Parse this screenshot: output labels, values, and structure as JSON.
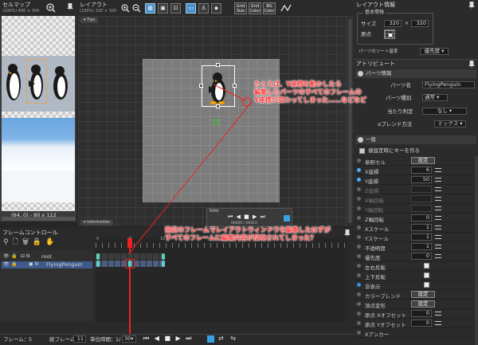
{
  "cellmap": {
    "title": "セルマップ",
    "zoom": "(100%) 400 × 304",
    "status": "(64, 0) - 80 x 112"
  },
  "layout": {
    "title": "レイアウト",
    "zoom": "(100%) 320 × 320",
    "tab": "▾ Tips",
    "info_tab": "▾ Information",
    "time_tab": "time",
    "time_counter": "00000 / 00010",
    "grid_size": "Grid\nSize",
    "grid_color": "Grid\nColor",
    "bg_color": "BG\nColor"
  },
  "layout_info": {
    "title": "レイアウト情報",
    "basic": "基本情報",
    "size_label": "サイズ",
    "size_w": "320",
    "size_x": "×",
    "size_h": "320",
    "origin_label": "原点",
    "sort_label": "パーツのソート基準",
    "sort_value": "優先度"
  },
  "attribute": {
    "title": "アトリビュート",
    "parts_info": "パーツ情報",
    "part_name_label": "パーツ名",
    "part_name": "FlyingPenguin",
    "part_type_label": "パーツ種別",
    "part_type": "通常",
    "hit_label": "当たり判定",
    "hit_value": "なし",
    "blend_label": "αブレンド方法",
    "blend_value": "ミックス",
    "general": "一般",
    "auto_key": "値設定時にキーを作る",
    "rows": [
      {
        "label": "参照セル",
        "value": "設定"
      },
      {
        "label": "X座標",
        "value": "6"
      },
      {
        "label": "Y座標",
        "value": "50"
      },
      {
        "label": "Z座標",
        "value": ""
      },
      {
        "label": "X軸回転",
        "value": ""
      },
      {
        "label": "Y軸回転",
        "value": ""
      },
      {
        "label": "Z軸回転",
        "value": "0"
      },
      {
        "label": "Xスケール",
        "value": "1"
      },
      {
        "label": "Yスケール",
        "value": "1"
      },
      {
        "label": "不透明度",
        "value": "1"
      },
      {
        "label": "優先度",
        "value": "0"
      },
      {
        "label": "左右反転",
        "value": ""
      },
      {
        "label": "上下反転",
        "value": ""
      },
      {
        "label": "非表示",
        "value": ""
      },
      {
        "label": "カラーブレンド",
        "value": "設定"
      },
      {
        "label": "頂点変形",
        "value": "設定"
      },
      {
        "label": "原点 Xオフセット",
        "value": "0"
      },
      {
        "label": "原点 Yオフセット",
        "value": "0"
      },
      {
        "label": "Xアンカー",
        "value": ""
      }
    ]
  },
  "frame_control": {
    "title": "フレームコントロール",
    "root": "root",
    "part": "FlyingPenguin",
    "ruler_0": "0",
    "ruler_5": "5",
    "ruler_10": "10"
  },
  "bottom": {
    "frame_label": "フレーム：",
    "frame_value": "5",
    "total_label": "総フレーム：",
    "total_value": "11",
    "unit_label": "単位時間：",
    "unit_value": "1/",
    "fps": "30"
  },
  "annotations": {
    "top": [
      "たとえば、Y座標を動かしたら",
      "編集したパーツのすべてのフレームの",
      "Y座標が変わってしまった……などなど"
    ],
    "bottom": [
      "指定のフレームでレイアウトウィンドウを編集したはずが",
      "すべてのフレームに編集内容が反映されてしまった？"
    ]
  }
}
